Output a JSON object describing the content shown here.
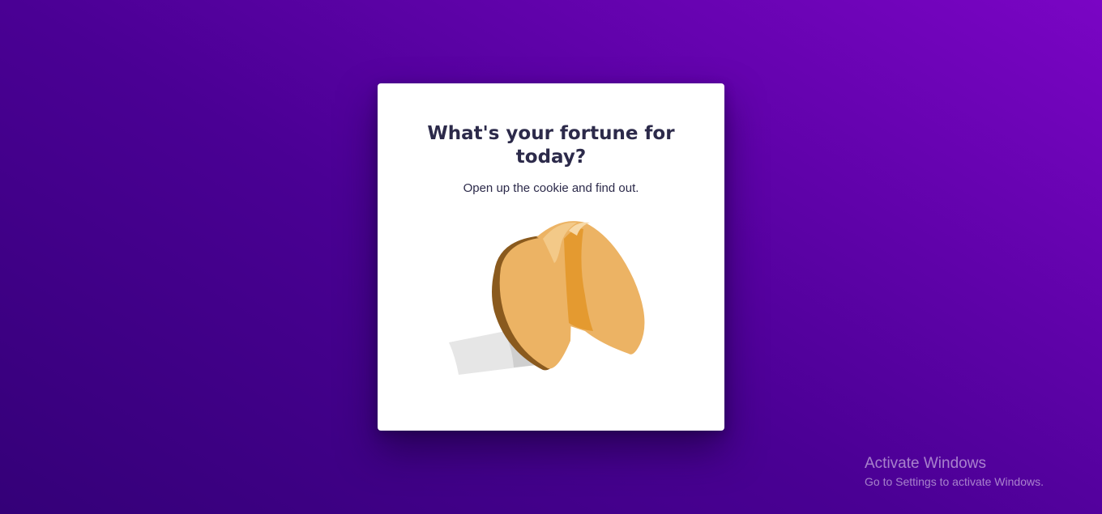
{
  "card": {
    "title": "What's your fortune for today?",
    "subtitle": "Open up the cookie and find out."
  },
  "illustration": {
    "icon": "fortune-cookie-icon",
    "colors": {
      "cookie": "#ecb364",
      "cookie_dark": "#e49a30",
      "cookie_shadow": "#8a5a1e",
      "paper": "#e6e6e6",
      "paper_shadow": "#cfcfcf"
    }
  },
  "watermark": {
    "title": "Activate Windows",
    "subtitle": "Go to Settings to activate Windows."
  },
  "theme": {
    "background_start": "#340078",
    "background_end": "#7a05c4",
    "text": "#2c2a4a"
  }
}
